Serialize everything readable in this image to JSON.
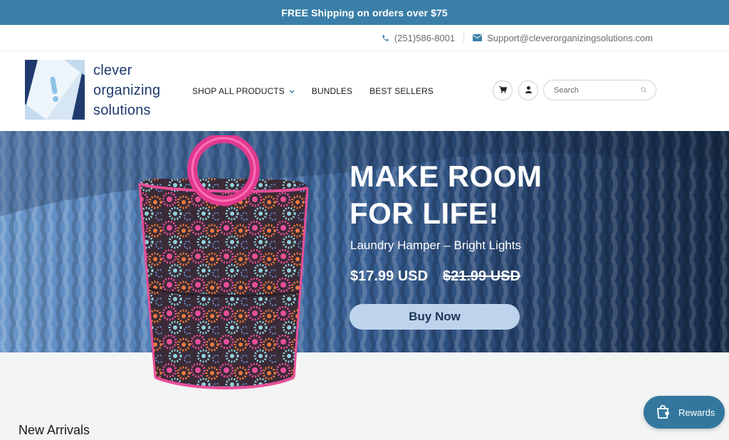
{
  "announcement": {
    "text": "FREE Shipping on orders over $75"
  },
  "contact": {
    "phone": "(251)586-8001",
    "email": "Support@cleverorganizingsolutions.com"
  },
  "logo": {
    "line1": "clever",
    "line2": "organizing",
    "line3": "solutions"
  },
  "nav": {
    "items": [
      {
        "label": "SHOP ALL PRODUCTS",
        "has_dropdown": true
      },
      {
        "label": "BUNDLES"
      },
      {
        "label": "BEST SELLERS"
      }
    ]
  },
  "header_icons": {
    "cart": "cart-icon",
    "account": "user-icon"
  },
  "search": {
    "placeholder": "Search",
    "value": ""
  },
  "hero": {
    "title_line1": "MAKE ROOM",
    "title_line2": "FOR LIFE!",
    "product_name": "Laundry Hamper – Bright Lights",
    "price": "$17.99 USD",
    "compare_price": "$21.99 USD",
    "button_label": "Buy Now"
  },
  "sections": {
    "new_arrivals": "New Arrivals"
  },
  "rewards": {
    "label": "Rewards"
  },
  "colors": {
    "announcement_bg": "#3a7fa8",
    "brand_navy": "#1f3b6e",
    "button_bg": "#bdd4ec",
    "rewards_bg": "#33779f"
  }
}
